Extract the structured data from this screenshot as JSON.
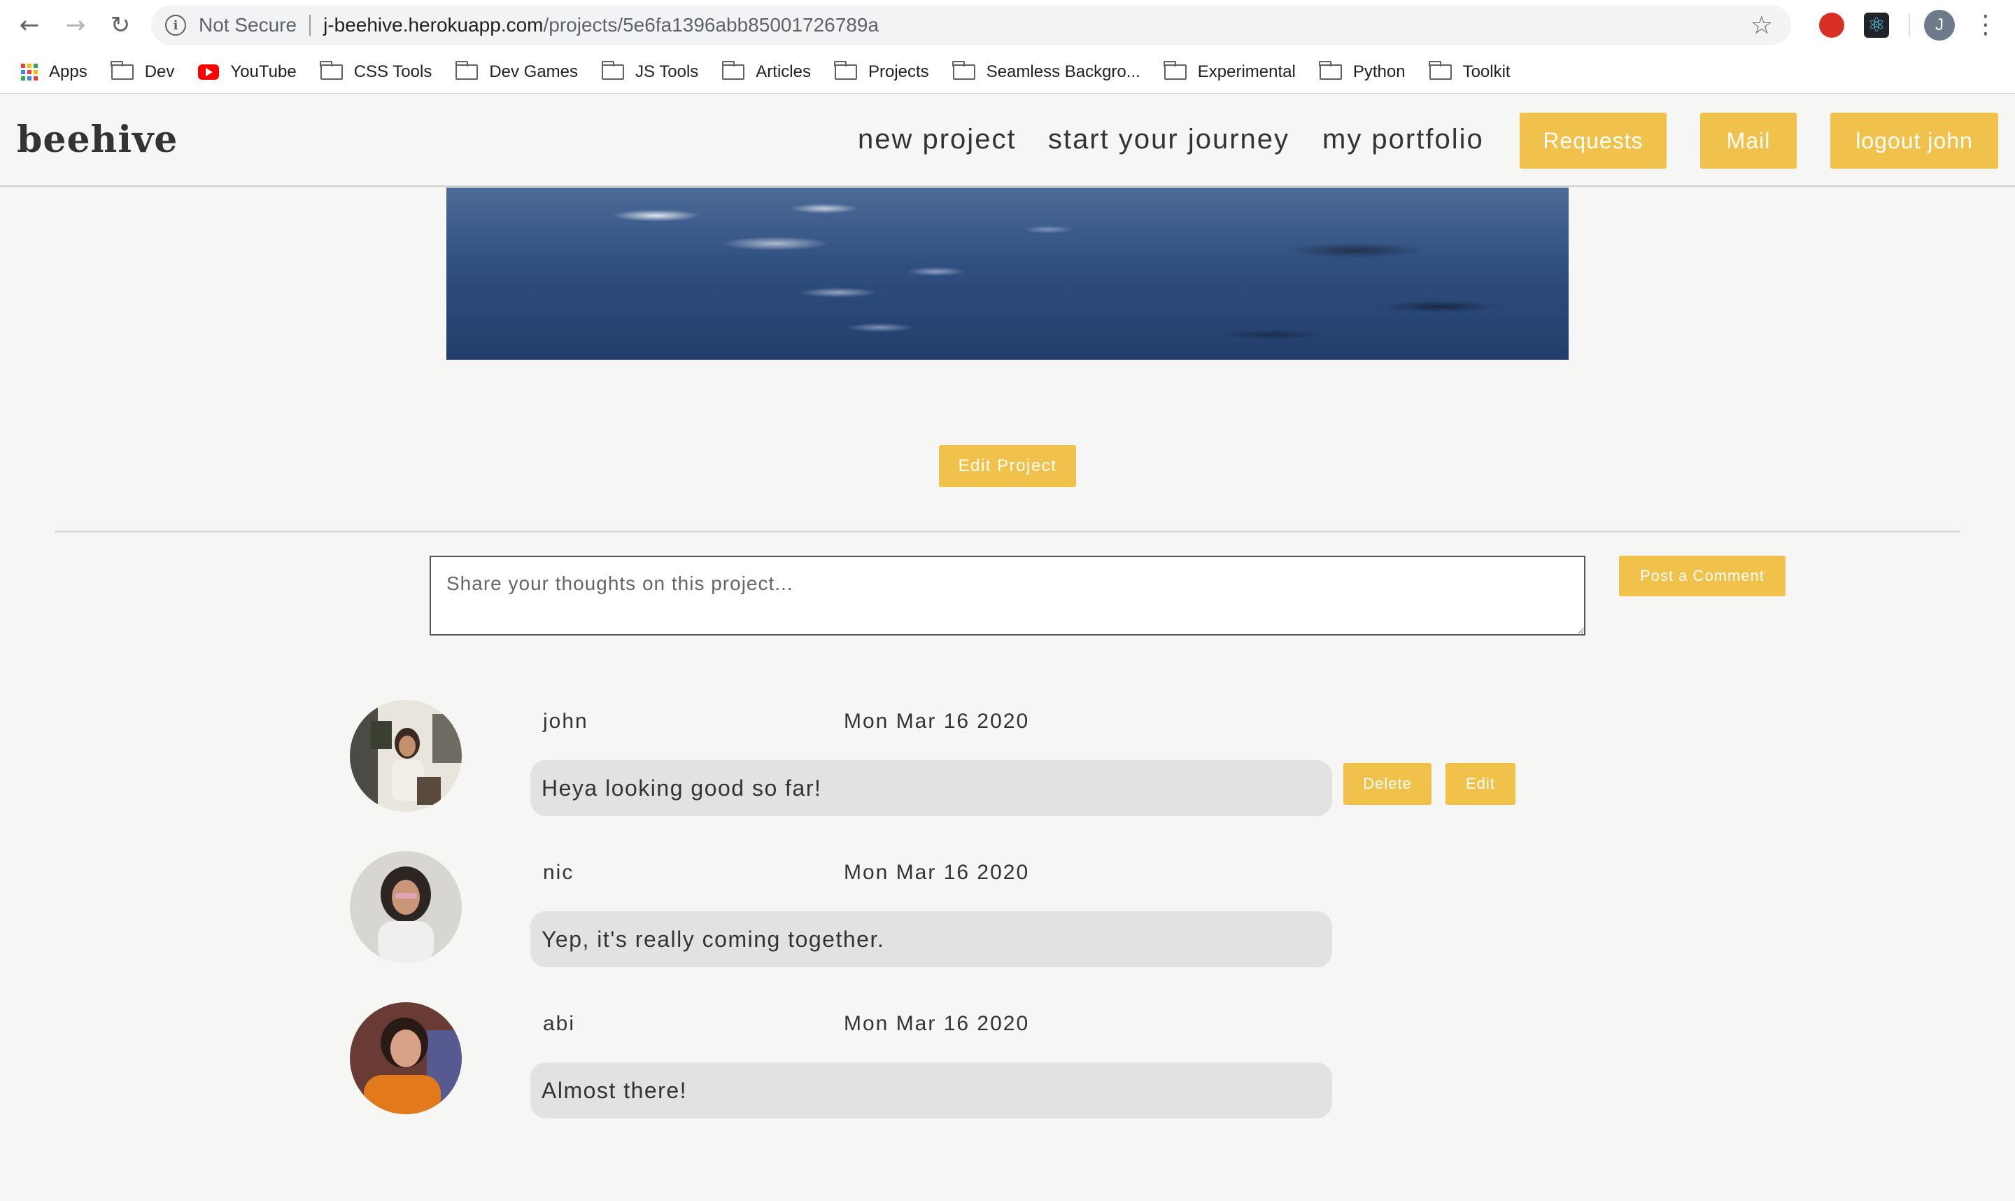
{
  "browser": {
    "security_label": "Not Secure",
    "url_host": "j-beehive.herokuapp.com",
    "url_path": "/projects/5e6fa1396abb85001726789a",
    "profile_initial": "J",
    "bookmarks": [
      "Apps",
      "Dev",
      "YouTube",
      "CSS Tools",
      "Dev Games",
      "JS Tools",
      "Articles",
      "Projects",
      "Seamless Backgro...",
      "Experimental",
      "Python",
      "Toolkit"
    ]
  },
  "site": {
    "brand": "beehive",
    "nav": {
      "new_project": "new project",
      "start_journey": "start your journey",
      "portfolio": "my portfolio",
      "requests": "Requests",
      "mail": "Mail",
      "logout": "logout john"
    },
    "accent_color": "#f0c24b"
  },
  "project": {
    "edit_label": "Edit Project"
  },
  "comment_form": {
    "placeholder": "Share your thoughts on this project...",
    "submit_label": "Post a Comment"
  },
  "comments": [
    {
      "user": "john",
      "date": "Mon Mar 16 2020",
      "text": "Heya looking good so far!",
      "delete_label": "Delete",
      "edit_label": "Edit"
    },
    {
      "user": "nic",
      "date": "Mon Mar 16 2020",
      "text": "Yep, it's really coming together."
    },
    {
      "user": "abi",
      "date": "Mon Mar 16 2020",
      "text": "Almost there!"
    }
  ]
}
